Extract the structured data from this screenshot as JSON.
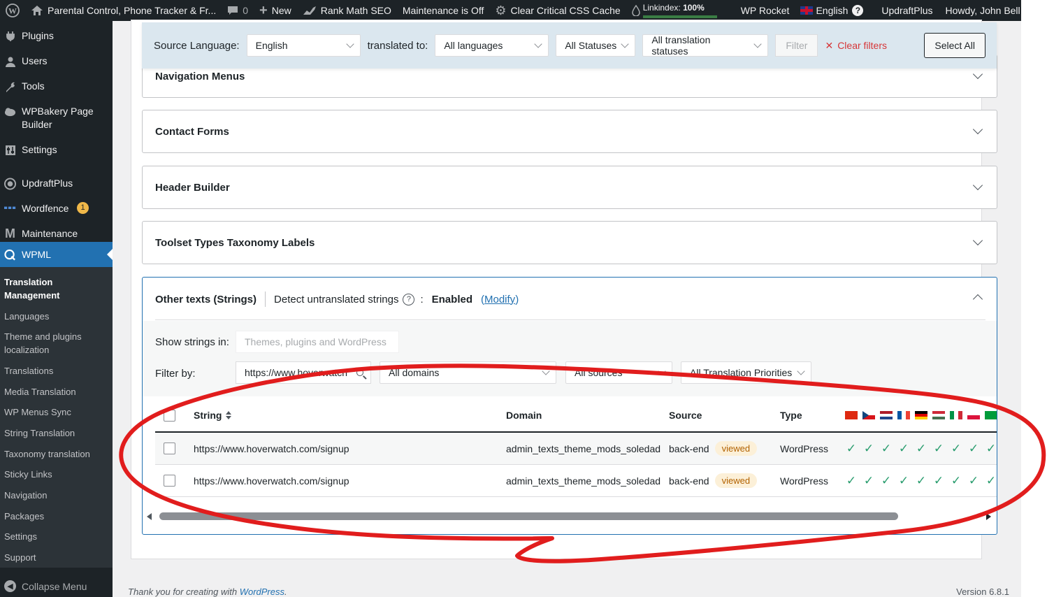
{
  "adminbar": {
    "site_name": "Parental Control, Phone Tracker & Fr...",
    "comments_count": "0",
    "new_label": "New",
    "rankmath_label": "Rank Math SEO",
    "maintenance_label": "Maintenance is Off",
    "css_cache_label": "Clear Critical CSS Cache",
    "linkindex_label": "Linkindex:",
    "linkindex_value": "100%",
    "wp_rocket_label": "WP Rocket",
    "language_label": "English",
    "updraft_label": "UpdraftPlus",
    "howdy_label": "Howdy, John Bell"
  },
  "sidebar": {
    "items": [
      {
        "label": "Plugins",
        "icon": "plug-icon"
      },
      {
        "label": "Users",
        "icon": "user-icon"
      },
      {
        "label": "Tools",
        "icon": "wrench-icon"
      },
      {
        "label": "WPBakery Page Builder",
        "icon": "cloud-icon"
      },
      {
        "label": "Settings",
        "icon": "settings-icon"
      },
      {
        "label": "UpdraftPlus",
        "icon": "updraft-icon"
      },
      {
        "label": "Wordfence",
        "icon": "wordfence-icon",
        "badge": "1"
      },
      {
        "label": "Maintenance",
        "icon": "maintenance-icon"
      },
      {
        "label": "WPML",
        "icon": "wpml-icon"
      }
    ],
    "submenu": [
      "Translation Management",
      "Languages",
      "Theme and plugins localization",
      "Translations",
      "Media Translation",
      "WP Menus Sync",
      "String Translation",
      "Taxonomy translation",
      "Sticky Links",
      "Navigation",
      "Packages",
      "Settings",
      "Support"
    ],
    "collapse_label": "Collapse Menu"
  },
  "filterbar": {
    "source_language_label": "Source Language:",
    "source_language_value": "English",
    "translated_to_label": "translated to:",
    "translated_to_value": "All languages",
    "statuses_value": "All Statuses",
    "translation_statuses_value": "All translation statuses",
    "filter_button": "Filter",
    "clear_filters": "Clear filters",
    "select_all": "Select All"
  },
  "sections": [
    {
      "title": "Navigation Menus"
    },
    {
      "title": "Contact Forms"
    },
    {
      "title": "Header Builder"
    },
    {
      "title": "Toolset Types Taxonomy Labels"
    }
  ],
  "strings_section": {
    "title": "Other texts (Strings)",
    "detect_label": "Detect untranslated strings",
    "help": "?",
    "colon": ":",
    "status": "Enabled",
    "modify_label": "Modify",
    "show_in_label": "Show strings in:",
    "show_in_placeholder": "Themes, plugins and WordPress",
    "filter_by_label": "Filter by:",
    "search_value": "https://www.hoverwatch",
    "domain_select": "All domains",
    "source_select": "All sources",
    "priority_select": "All Translation Priorities",
    "columns": {
      "string": "String",
      "domain": "Domain",
      "source": "Source",
      "type": "Type"
    },
    "rows": [
      {
        "string": "https://www.hoverwatch.com/signup",
        "domain": "admin_texts_theme_mods_soledad",
        "source": "back-end",
        "status": "viewed",
        "type": "WordPress"
      },
      {
        "string": "https://www.hoverwatch.com/signup",
        "domain": "admin_texts_theme_mods_soledad",
        "source": "back-end",
        "status": "viewed",
        "type": "WordPress"
      }
    ],
    "flags": [
      "china-flag",
      "czech-flag",
      "netherlands-flag",
      "france-flag",
      "germany-flag",
      "hungary-flag",
      "italy-flag",
      "poland-flag",
      "brazil-flag"
    ]
  },
  "footer": {
    "thanks_prefix": "Thank you for creating with",
    "wordpress_link": "WordPress",
    "thanks_suffix": ".",
    "version": "Version 6.8.1"
  },
  "colors": {
    "admin_dark": "#1d2327",
    "wp_blue": "#2271b1",
    "check_green": "#2a9d6f",
    "annotation_red": "#e11d1d",
    "filterbar_bg": "#dbe7ef"
  }
}
